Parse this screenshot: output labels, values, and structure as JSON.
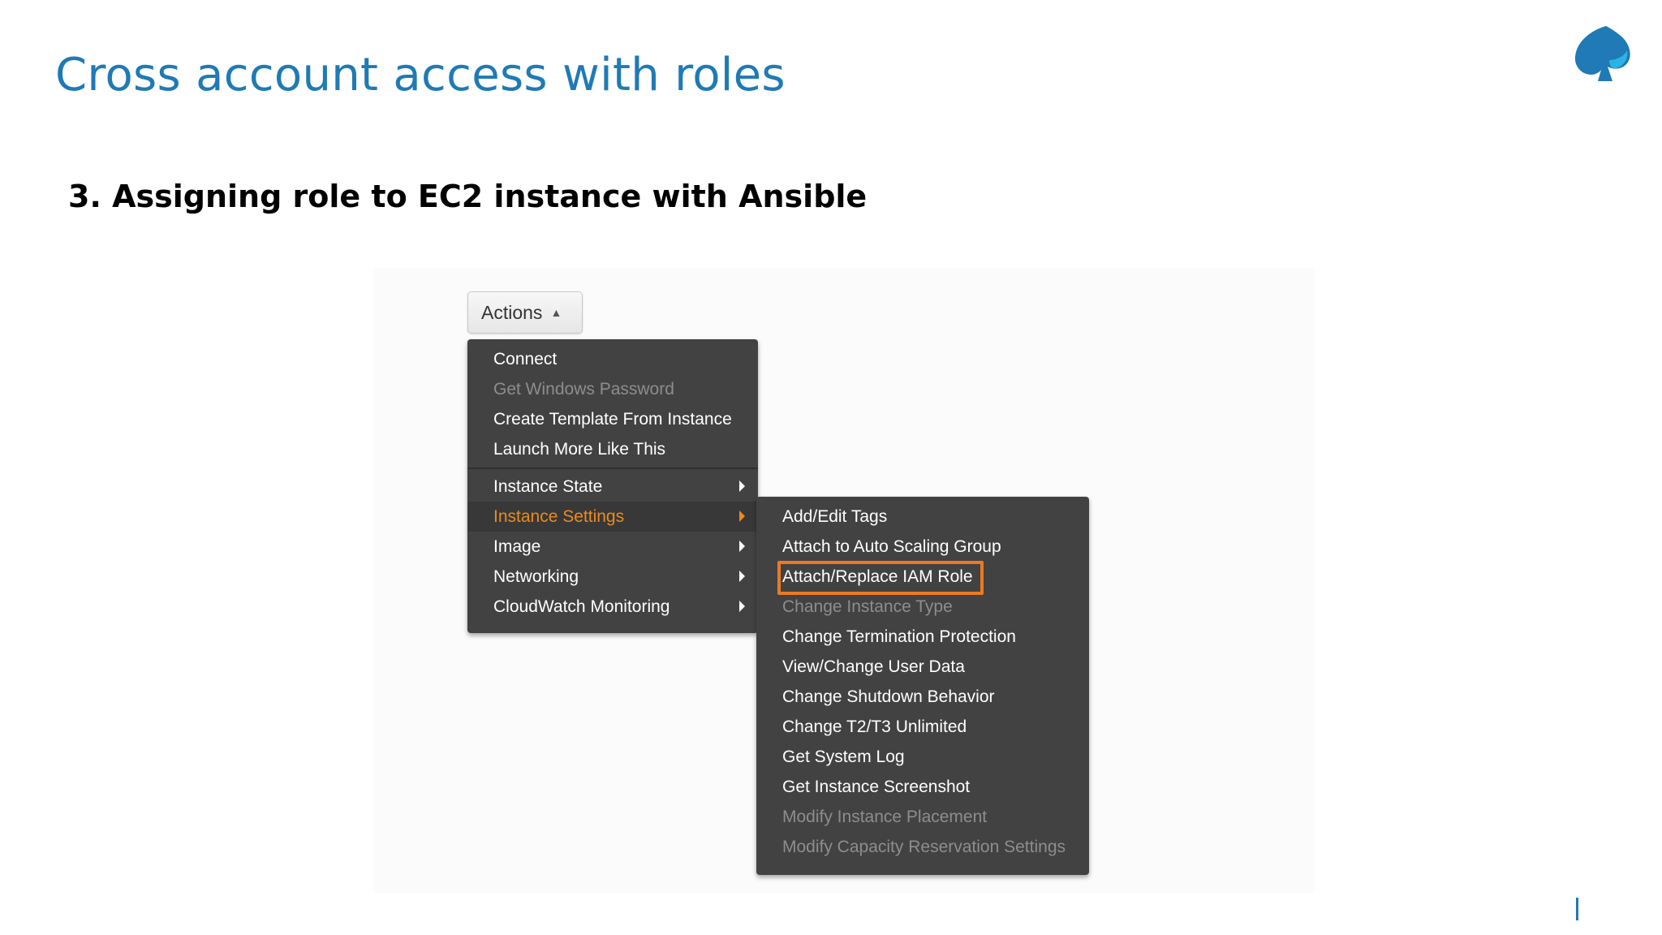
{
  "slide": {
    "title": "Cross account access with roles",
    "subtitle": "3. Assigning role to EC2 instance with Ansible"
  },
  "actions_button": {
    "label": "Actions",
    "icon": "chevron-up-icon"
  },
  "main_menu": {
    "items": [
      {
        "label": "Connect",
        "disabled": false
      },
      {
        "label": "Get Windows Password",
        "disabled": true
      },
      {
        "label": "Create Template From Instance",
        "disabled": false
      },
      {
        "label": "Launch More Like This",
        "disabled": false
      },
      {
        "label": "Instance State",
        "submenu": true
      },
      {
        "label": "Instance Settings",
        "submenu": true,
        "active": true
      },
      {
        "label": "Image",
        "submenu": true
      },
      {
        "label": "Networking",
        "submenu": true
      },
      {
        "label": "CloudWatch Monitoring",
        "submenu": true
      }
    ]
  },
  "sub_menu": {
    "items": [
      {
        "label": "Add/Edit Tags",
        "disabled": false
      },
      {
        "label": "Attach to Auto Scaling Group",
        "disabled": false
      },
      {
        "label": "Attach/Replace IAM Role",
        "disabled": false,
        "highlighted": true
      },
      {
        "label": "Change Instance Type",
        "disabled": true
      },
      {
        "label": "Change Termination Protection",
        "disabled": false
      },
      {
        "label": "View/Change User Data",
        "disabled": false
      },
      {
        "label": "Change Shutdown Behavior",
        "disabled": false
      },
      {
        "label": "Change T2/T3 Unlimited",
        "disabled": false
      },
      {
        "label": "Get System Log",
        "disabled": false
      },
      {
        "label": "Get Instance Screenshot",
        "disabled": false
      },
      {
        "label": "Modify Instance Placement",
        "disabled": true
      },
      {
        "label": "Modify Capacity Reservation Settings",
        "disabled": true
      }
    ]
  },
  "colors": {
    "title": "#1f7ab5",
    "menu_bg": "#424242",
    "active_text": "#ec8a1f",
    "highlight_border": "#ec7a23"
  },
  "logo": {
    "icon": "spade-logo-icon"
  }
}
